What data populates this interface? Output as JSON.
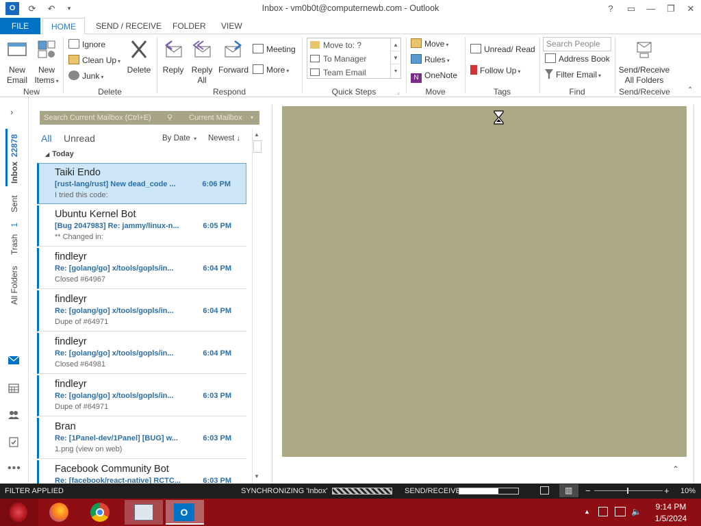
{
  "window": {
    "title": "Inbox - vm0b0t@computernewb.com - Outlook",
    "controls": {
      "help": "?",
      "restore": "▭",
      "minimize": "—",
      "maximize": "❐",
      "close": "✕"
    }
  },
  "tabs": [
    "FILE",
    "HOME",
    "SEND / RECEIVE",
    "FOLDER",
    "VIEW"
  ],
  "ribbon": {
    "new": {
      "label": "New",
      "new_email": "New\nEmail",
      "new_items": "New\nItems"
    },
    "delete": {
      "label": "Delete",
      "ignore": "Ignore",
      "clean_up": "Clean Up",
      "junk": "Junk",
      "delete": "Delete"
    },
    "respond": {
      "label": "Respond",
      "reply": "Reply",
      "reply_all": "Reply\nAll",
      "forward": "Forward",
      "meeting": "Meeting",
      "more": "More"
    },
    "quick_steps": {
      "label": "Quick Steps",
      "items": [
        "Move to: ?",
        "To Manager",
        "Team Email"
      ]
    },
    "move": {
      "label": "Move",
      "move": "Move",
      "rules": "Rules",
      "onenote": "OneNote"
    },
    "tags": {
      "label": "Tags",
      "unread_read": "Unread/ Read",
      "follow_up": "Follow Up"
    },
    "find": {
      "label": "Find",
      "search_people_placeholder": "Search People",
      "address_book": "Address Book",
      "filter_email": "Filter Email"
    },
    "send_receive": {
      "label": "Send/Receive",
      "button": "Send/Receive\nAll Folders"
    }
  },
  "leftnav": {
    "inbox_label": "Inbox",
    "inbox_count": "22878",
    "sent_label": "Sent",
    "trash_label": "Trash",
    "trash_count": "1",
    "all_folders_label": "All Folders",
    "icons": [
      "mail-icon",
      "calendar-icon",
      "people-icon",
      "tasks-icon",
      "more-icon"
    ]
  },
  "maillist": {
    "search_placeholder": "Search Current Mailbox (Ctrl+E)",
    "scope": "Current Mailbox",
    "filter_all": "All",
    "filter_unread": "Unread",
    "sort_by": "By Date",
    "sort_order": "Newest",
    "group_header": "Today",
    "items": [
      {
        "from": "Taiki Endo",
        "subject": "[rust-lang/rust] New dead_code ...",
        "time": "6:06 PM",
        "preview": "I tried this code:",
        "selected": true
      },
      {
        "from": "Ubuntu Kernel Bot",
        "subject": "[Bug 2047983] Re: jammy/linux-n...",
        "time": "6:05 PM",
        "preview": "** Changed in:"
      },
      {
        "from": "findleyr",
        "subject": "Re: [golang/go] x/tools/gopls/in...",
        "time": "6:04 PM",
        "preview": "Closed #64967"
      },
      {
        "from": "findleyr",
        "subject": "Re: [golang/go] x/tools/gopls/in...",
        "time": "6:04 PM",
        "preview": "Dupe of #64971"
      },
      {
        "from": "findleyr",
        "subject": "Re: [golang/go] x/tools/gopls/in...",
        "time": "6:04 PM",
        "preview": "Closed #64981"
      },
      {
        "from": "findleyr",
        "subject": "Re: [golang/go] x/tools/gopls/in...",
        "time": "6:03 PM",
        "preview": "Dupe of #64971"
      },
      {
        "from": "Bran",
        "subject": "Re: [1Panel-dev/1Panel] [BUG] w...",
        "time": "6:03 PM",
        "preview": "1.png (view on web)"
      },
      {
        "from": "Facebook Community Bot",
        "subject": "Re: [facebook/react-native] RCTC...",
        "time": "6:03 PM",
        "preview": ""
      }
    ]
  },
  "statusbar": {
    "filter": "FILTER APPLIED",
    "sync": "SYNCHRONIZING  'Inbox'",
    "send_receive": "SEND/RECEIVE",
    "zoom": "10%"
  },
  "taskbar": {
    "time": "9:14 PM",
    "date": "1/5/2024"
  },
  "colors": {
    "accent": "#0072c6",
    "reading_pane": "#aca986",
    "taskbar": "#8e0e14",
    "statusbar": "#1e1e1e"
  }
}
